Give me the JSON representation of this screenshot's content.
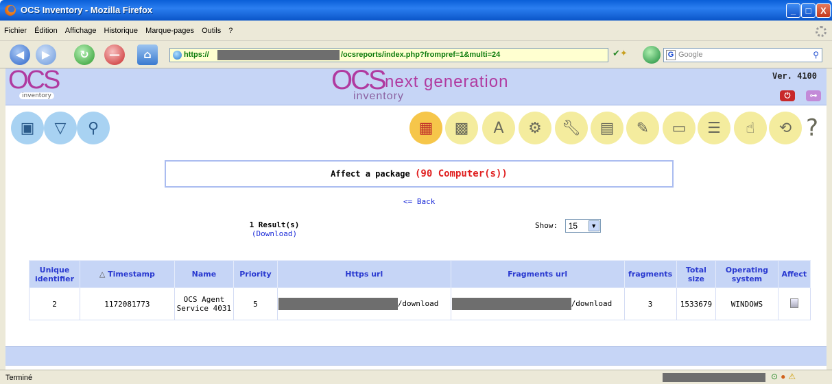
{
  "window": {
    "title": "OCS Inventory - Mozilla Firefox",
    "min": "_",
    "max": "□",
    "close": "X"
  },
  "menu": [
    "Fichier",
    "Édition",
    "Affichage",
    "Historique",
    "Marque-pages",
    "Outils",
    "?"
  ],
  "address": {
    "scheme": "https://",
    "path": "/ocsreports/index.php?frompref=1&multi=24"
  },
  "search": {
    "placeholder": "Google",
    "engine_letter": "G"
  },
  "header": {
    "logo_left": "OCS",
    "logo_left_sub": "inventory",
    "logo_center": "OCS",
    "logo_center_ng": "next generation",
    "logo_center_sub": "inventory",
    "version": "Ver. 4100"
  },
  "toolbar_left_icons": [
    "computers-icon",
    "filter-icon",
    "search-icon"
  ],
  "toolbar_right_icons": [
    "package-icon",
    "firewall-icon",
    "dictionary-icon",
    "config-icon",
    "tools-icon",
    "registry-icon",
    "notes-icon",
    "devices-icon",
    "document-icon",
    "upload-icon",
    "backup-icon",
    "help-icon"
  ],
  "affect": {
    "label": "Affect a package",
    "count": "(90 Computer(s))"
  },
  "back_link": "<= Back",
  "results": {
    "count": "1 Result(s)",
    "download": "(Download)"
  },
  "show": {
    "label": "Show:",
    "value": "15"
  },
  "table": {
    "headers": [
      "Unique identifier",
      "Timestamp",
      "Name",
      "Priority",
      "Https url",
      "Fragments url",
      "fragments",
      "Total size",
      "Operating system",
      "Affect"
    ],
    "rows": [
      {
        "id": "2",
        "timestamp": "1172081773",
        "name": "OCS Agent Service 4031",
        "priority": "5",
        "https_suffix": "/download",
        "frag_suffix": "/download",
        "fragments": "3",
        "size": "1533679",
        "os": "WINDOWS"
      }
    ]
  },
  "status": {
    "text": "Terminé"
  },
  "colors": {
    "header_band": "#c6d5f6",
    "accent_link": "#1a2ad8",
    "count_red": "#e02020",
    "logo_purple": "#b03aa0"
  }
}
